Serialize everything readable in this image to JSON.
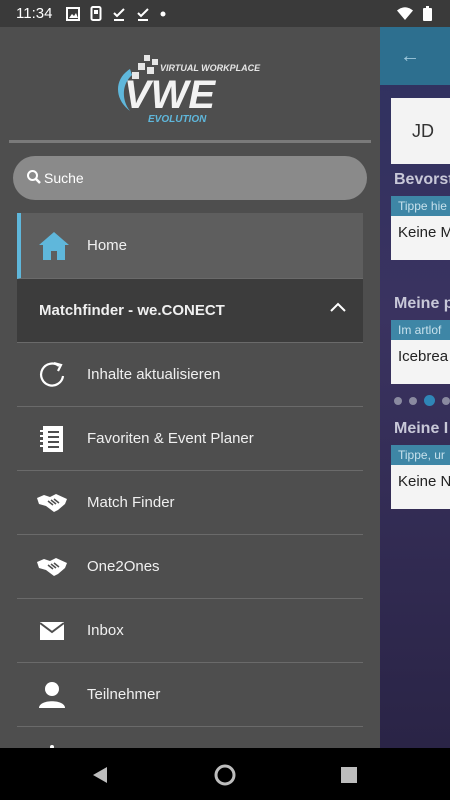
{
  "status_bar": {
    "time": "11:34"
  },
  "drawer": {
    "logo": {
      "main": "VWE",
      "top": "VIRTUAL WORKPLACE",
      "bottom": "EVOLUTION"
    },
    "search": {
      "placeholder": "Suche"
    },
    "home": {
      "label": "Home",
      "icon": "home-icon"
    },
    "group": {
      "label": "Matchfinder - we.CONECT",
      "icon": "chevron-up-icon"
    },
    "items": [
      {
        "label": "Inhalte aktualisieren",
        "icon": "refresh-icon"
      },
      {
        "label": "Favoriten & Event Planer",
        "icon": "notebook-icon"
      },
      {
        "label": "Match Finder",
        "icon": "handshake-icon"
      },
      {
        "label": "One2Ones",
        "icon": "handshake-icon"
      },
      {
        "label": "Inbox",
        "icon": "mail-icon"
      },
      {
        "label": "Teilnehmer",
        "icon": "person-icon"
      }
    ]
  },
  "background_app": {
    "avatar_initials": "JD",
    "sections": [
      {
        "title": "Bevorst",
        "hint": "Tippe hie",
        "value": "Keine M"
      },
      {
        "title": "Meine p",
        "hint": "Im artlof",
        "value": "Icebrea"
      },
      {
        "title": "Meine I",
        "hint": "Tippe, ur",
        "value": "Keine N"
      }
    ]
  },
  "colors": {
    "accent": "#5fb7db",
    "drawer_bg": "#4e4e4e",
    "group_bg": "#3c3c3c",
    "app_bar": "#2d6f8f"
  }
}
